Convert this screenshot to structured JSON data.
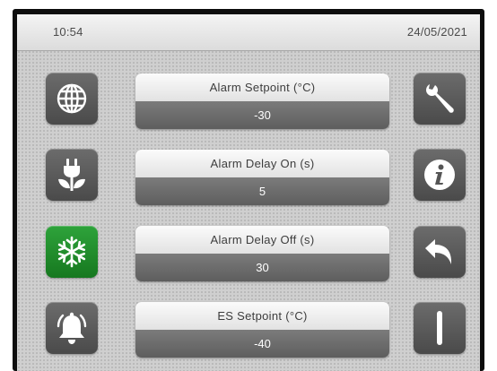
{
  "statusbar": {
    "time": "10:54",
    "date": "24/05/2021"
  },
  "parameters": [
    {
      "label": "Alarm Setpoint (°C)",
      "value": "-30"
    },
    {
      "label": "Alarm Delay On (s)",
      "value": "5"
    },
    {
      "label": "Alarm Delay Off (s)",
      "value": "30"
    },
    {
      "label": "ES Setpoint (°C)",
      "value": "-40"
    }
  ],
  "left_buttons": [
    {
      "icon": "globe-icon",
      "active": false
    },
    {
      "icon": "plug-leaf-icon",
      "active": false
    },
    {
      "icon": "snowflake-icon",
      "active": true
    },
    {
      "icon": "alarm-bell-icon",
      "active": false
    }
  ],
  "right_buttons": [
    {
      "icon": "wrench-icon"
    },
    {
      "icon": "info-icon"
    },
    {
      "icon": "back-arrow-icon"
    },
    {
      "icon": "power-bar-icon"
    }
  ],
  "colors": {
    "active_button": "#22912f",
    "button": "#5a5a5a",
    "value_field": "#6b6b6b",
    "background": "#cfcfcf"
  }
}
